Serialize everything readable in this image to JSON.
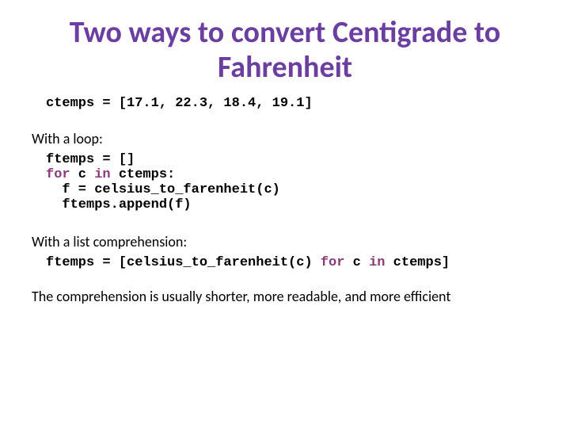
{
  "title": "Two ways to convert Centigrade to Fahrenheit",
  "code_initial_pre": "ctemps = [17.1, 22.3, 18.4, 19.1]",
  "section1": {
    "label": "With a loop:",
    "line1_a": "ftemps = []",
    "line2_kw1": "for",
    "line2_mid": " c ",
    "line2_kw2": "in",
    "line2_end": " ctemps:",
    "line3": "  f = celsius_to_farenheit(c)",
    "line4": "  ftemps.append(f)"
  },
  "section2": {
    "label": "With a list comprehension:",
    "line1_a": "ftemps = [celsius_to_farenheit(c) ",
    "line1_kw1": "for",
    "line1_mid": " c ",
    "line1_kw2": "in",
    "line1_end": " ctemps]"
  },
  "footer": "The comprehension is usually shorter, more readable, and more efficient"
}
